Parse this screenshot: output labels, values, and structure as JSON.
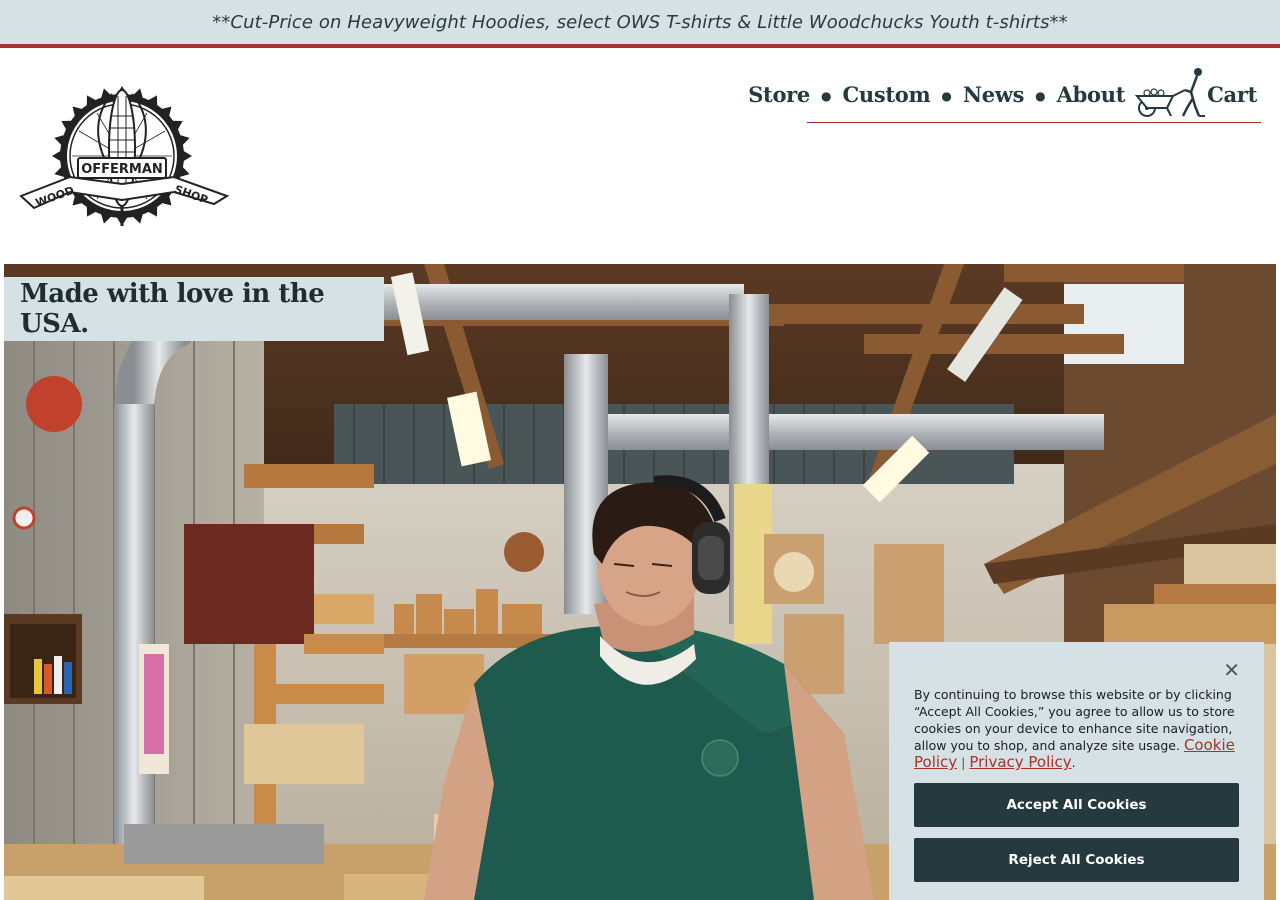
{
  "announcement": {
    "text": "**Cut-Price on Heavyweight Hoodies, select OWS T-shirts & Little Woodchucks Youth t-shirts**"
  },
  "logo": {
    "name": "offerman-wood-shop-logo",
    "words": [
      "OFFERMAN",
      "WOOD",
      "SHOP"
    ]
  },
  "nav": {
    "items": [
      {
        "label": "Store"
      },
      {
        "label": "Custom"
      },
      {
        "label": "News"
      },
      {
        "label": "About"
      }
    ],
    "cart": {
      "label": "Cart",
      "icon": "wheelbarrow-man-icon"
    }
  },
  "hero": {
    "tagline": "Made with love in the USA.",
    "image": "woodshop-worker-with-ear-protection"
  },
  "cookie_banner": {
    "text": "By continuing to browse this website or by clicking “Accept All Cookies,” you agree to allow us to store cookies on your device to enhance site navigation, allow you to shop, and analyze site usage.",
    "cookie_policy_link": "Cookie Policy",
    "separator": "|",
    "privacy_policy_link": "Privacy Policy",
    "period": ".",
    "accept_label": "Accept All Cookies",
    "reject_label": "Reject All Cookies",
    "close_icon": "close-icon"
  },
  "colors": {
    "accent_red": "#a8322a",
    "dark_teal": "#26393e",
    "light_blue_gray": "#d5e1e5"
  }
}
